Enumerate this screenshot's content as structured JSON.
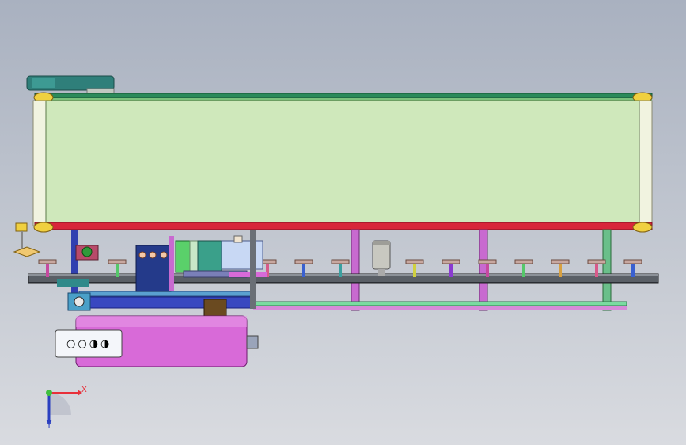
{
  "viewport": {
    "background_top": "#a9b1c0",
    "background_bottom": "#d9dbe0"
  },
  "triad": {
    "x_label": "X",
    "y_label": "Y",
    "x_color": "#e8303a",
    "y_color": "#2a3fc0",
    "origin_color": "#3fbf3f"
  },
  "model": {
    "belt_color": "#cfe8bb",
    "belt_bottom_rail_color": "#d8263a",
    "motor_color": "#d86ad8",
    "motor_badge_symbols": [
      "○",
      "○",
      "◑",
      "◑"
    ],
    "guide_rail_colors": [
      "#55c86a",
      "#c64aa0",
      "#7a7fb8",
      "#5aa0d0"
    ],
    "hopper_color": "#2f7f7a",
    "control_box_color": "#243a8a"
  }
}
